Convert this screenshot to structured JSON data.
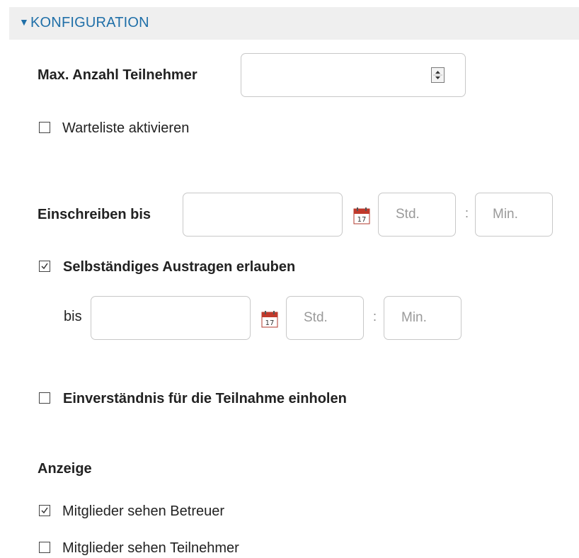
{
  "section": {
    "title": "KONFIGURATION"
  },
  "max_participants": {
    "label": "Max. Anzahl Teilnehmer",
    "value": ""
  },
  "waitlist": {
    "label": "Warteliste aktivieren",
    "checked": false
  },
  "enroll_until": {
    "label": "Einschreiben bis",
    "date_value": "",
    "hour_placeholder": "Std.",
    "separator": ":",
    "minute_placeholder": "Min."
  },
  "self_unenroll": {
    "label": "Selbständiges Austragen erlauben",
    "checked": true,
    "until_label": "bis",
    "date_value": "",
    "hour_placeholder": "Std.",
    "separator": ":",
    "minute_placeholder": "Min."
  },
  "consent": {
    "label": "Einverständnis für die Teilnahme einholen",
    "checked": false
  },
  "display": {
    "heading": "Anzeige",
    "options": [
      {
        "label": "Mitglieder sehen Betreuer",
        "checked": true
      },
      {
        "label": "Mitglieder sehen Teilnehmer",
        "checked": false
      }
    ]
  },
  "colors": {
    "accent": "#1f6fa8",
    "header_bg": "#efefef",
    "calendar_red": "#c0392b"
  }
}
